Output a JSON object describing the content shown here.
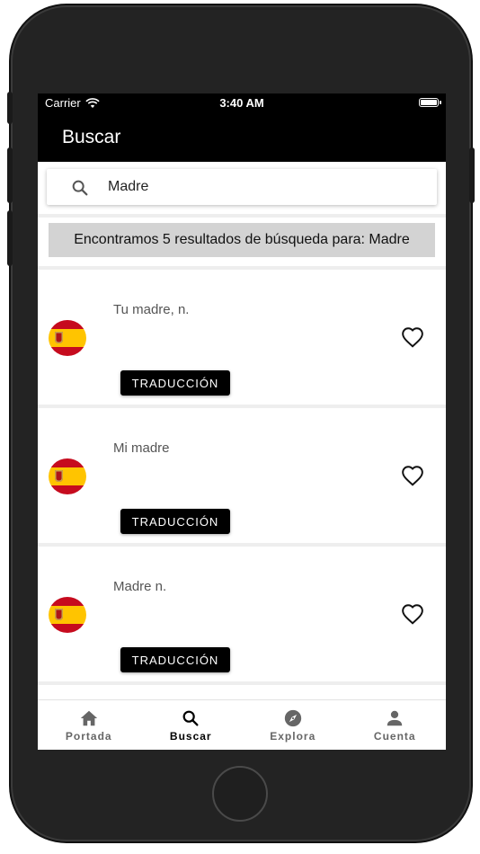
{
  "status_bar": {
    "carrier": "Carrier",
    "time": "3:40 AM"
  },
  "app_bar": {
    "title": "Buscar"
  },
  "search": {
    "value": "Madre",
    "icon": "search-icon"
  },
  "results_banner": "Encontramos 5 resultados de búsqueda para: Madre",
  "results": [
    {
      "title": "Tu madre, n.",
      "flag": "spain-flag",
      "button_label": "TRADUCCIÓN",
      "favorite_icon": "heart-outline-icon"
    },
    {
      "title": "Mi madre",
      "flag": "spain-flag",
      "button_label": "TRADUCCIÓN",
      "favorite_icon": "heart-outline-icon"
    },
    {
      "title": "Madre n.",
      "flag": "spain-flag",
      "button_label": "TRADUCCIÓN",
      "favorite_icon": "heart-outline-icon"
    }
  ],
  "bottom_nav": [
    {
      "label": "Portada",
      "icon": "home-icon",
      "active": false
    },
    {
      "label": "Buscar",
      "icon": "search-icon",
      "active": true
    },
    {
      "label": "Explora",
      "icon": "compass-icon",
      "active": false
    },
    {
      "label": "Cuenta",
      "icon": "person-icon",
      "active": false
    }
  ],
  "colors": {
    "app_bar": "#000000",
    "banner": "#d3d3d3",
    "button": "#000000",
    "flag_red": "#c60b1e",
    "flag_yellow": "#ffc400"
  }
}
